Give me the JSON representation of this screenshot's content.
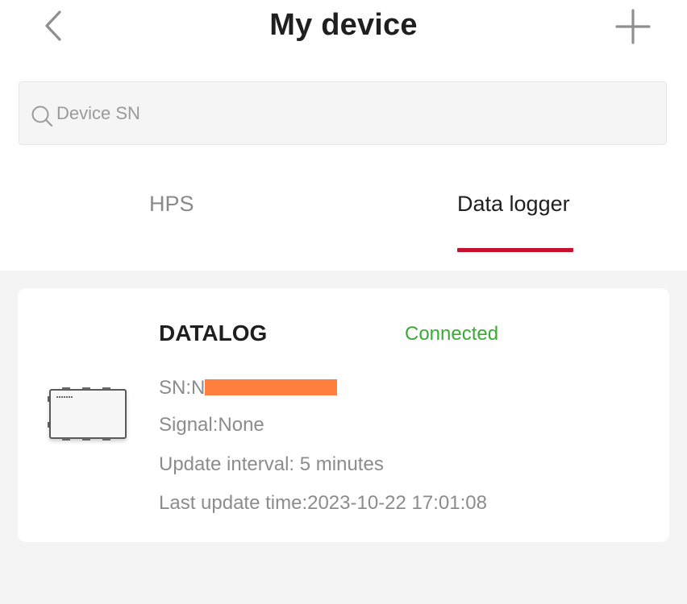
{
  "header": {
    "title": "My device",
    "back_icon": "chevron-left-icon",
    "add_icon": "plus-icon"
  },
  "search": {
    "placeholder": "Device SN",
    "value": "",
    "icon": "search-icon"
  },
  "tabs": [
    {
      "label": "HPS",
      "active": false
    },
    {
      "label": "Data logger",
      "active": true
    }
  ],
  "device": {
    "name": "DATALOG",
    "status": "Connected",
    "sn_prefix": "SN:N",
    "signal": "Signal:None",
    "update_interval": "Update interval: 5 minutes",
    "last_update": "Last update time:2023-10-22 17:01:08",
    "icon": "datalogger-device-icon"
  },
  "colors": {
    "accent": "#c8102e",
    "status_connected": "#3aaa35",
    "redaction": "#ff7f3f",
    "background": "#f4f4f4"
  }
}
